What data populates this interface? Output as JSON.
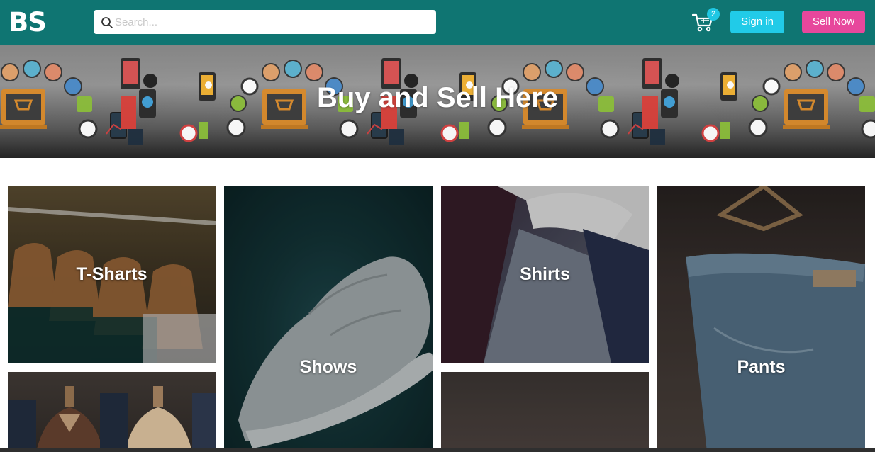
{
  "navbar": {
    "logo": "BS",
    "search_placeholder": "Search...",
    "cart_count": "2",
    "signin_label": "Sign in",
    "sell_label": "Sell Now",
    "colors": {
      "bar": "#0f7572",
      "signin": "#21cbe8",
      "sell": "#e7479c",
      "badge": "#1fc7e3"
    }
  },
  "hero": {
    "title": "Buy and Sell Here"
  },
  "categories": {
    "tshirts": "T-Sharts",
    "shows": "Shows",
    "shirts": "Shirts",
    "pants": "Pants"
  },
  "icons": [
    "search-icon",
    "cart-icon"
  ]
}
